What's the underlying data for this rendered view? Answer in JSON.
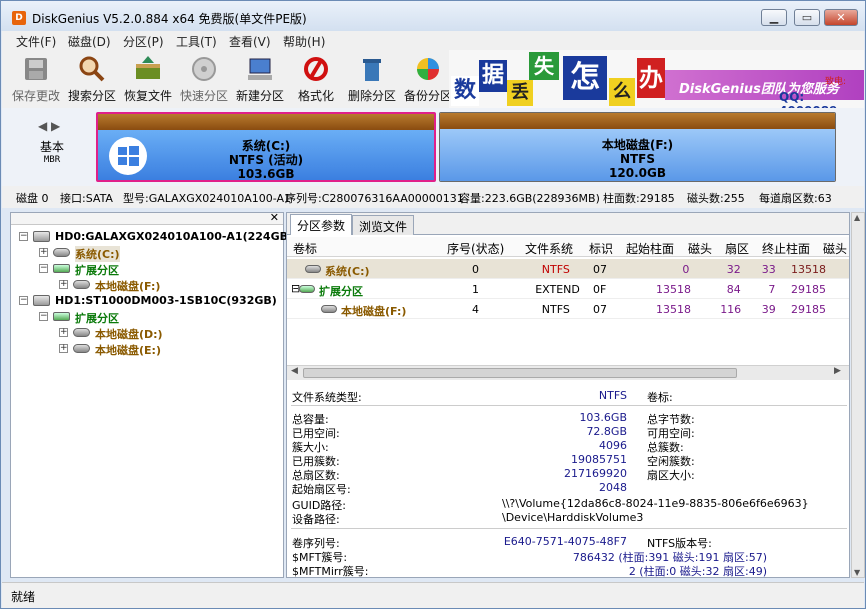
{
  "window": {
    "title": "DiskGenius V5.2.0.884 x64 免费版(单文件PE版)"
  },
  "menu": [
    "文件(F)",
    "磁盘(D)",
    "分区(P)",
    "工具(T)",
    "查看(V)",
    "帮助(H)"
  ],
  "toolbar": [
    {
      "label": "保存更改",
      "icon": "save-changes-icon",
      "enabled": false
    },
    {
      "label": "搜索分区",
      "icon": "search-partition-icon",
      "enabled": true
    },
    {
      "label": "恢复文件",
      "icon": "recover-files-icon",
      "enabled": true
    },
    {
      "label": "快速分区",
      "icon": "quick-partition-icon",
      "enabled": false
    },
    {
      "label": "新建分区",
      "icon": "new-partition-icon",
      "enabled": true
    },
    {
      "label": "格式化",
      "icon": "format-icon",
      "enabled": true
    },
    {
      "label": "删除分区",
      "icon": "delete-partition-icon",
      "enabled": true
    },
    {
      "label": "备份分区",
      "icon": "backup-partition-icon",
      "enabled": true
    }
  ],
  "banner": {
    "chars": [
      "数",
      "据",
      "丢",
      "失",
      "怎",
      "么",
      "办"
    ],
    "brand": "DiskGenius团队为您服务",
    "tag": "致电:",
    "qq": "QQ: 4000089"
  },
  "diskmap": {
    "basic": "基本",
    "mbr": "MBR",
    "partitions": [
      {
        "name": "系统(C:)",
        "fs": "NTFS (活动)",
        "size": "103.6GB",
        "selected": true
      },
      {
        "name": "本地磁盘(F:)",
        "fs": "NTFS",
        "size": "120.0GB",
        "selected": false
      }
    ]
  },
  "diskinfo": {
    "disk": "磁盘 0",
    "iface": "接口:SATA",
    "model": "型号:GALAXGX024010A100-A1",
    "serial": "序列号:C280076316AA00000131",
    "capacity": "容量:223.6GB(228936MB)",
    "cylinders": "柱面数:29185",
    "heads": "磁头数:255",
    "spt": "每道扇区数:63"
  },
  "tree": [
    {
      "label": "HD0:GALAXGX024010A100-A1(224GB)",
      "type": "disk",
      "level": 0,
      "color": "#000"
    },
    {
      "label": "系统(C:)",
      "type": "part",
      "level": 1,
      "color": "#8a5a00"
    },
    {
      "label": "扩展分区",
      "type": "ext",
      "level": 1,
      "color": "#0a7a0a"
    },
    {
      "label": "本地磁盘(F:)",
      "type": "part",
      "level": 2,
      "color": "#8a5a00"
    },
    {
      "label": "HD1:ST1000DM003-1SB10C(932GB)",
      "type": "disk",
      "level": 0,
      "color": "#000"
    },
    {
      "label": "扩展分区",
      "type": "ext",
      "level": 1,
      "color": "#0a7a0a"
    },
    {
      "label": "本地磁盘(D:)",
      "type": "part",
      "level": 2,
      "color": "#8a5a00"
    },
    {
      "label": "本地磁盘(E:)",
      "type": "part",
      "level": 2,
      "color": "#8a5a00"
    }
  ],
  "tabs": [
    "分区参数",
    "浏览文件"
  ],
  "table": {
    "headers": [
      "卷标",
      "序号(状态)",
      "文件系统",
      "标识",
      "起始柱面",
      "磁头",
      "扇区",
      "终止柱面",
      "磁头"
    ],
    "rows": [
      {
        "label": "系统(C:)",
        "num": "0",
        "fs": "NTFS",
        "id": "07",
        "sc": "0",
        "sh": "32",
        "ss": "33",
        "ec": "13518",
        "eh": "84",
        "color": "#8a5a00",
        "fscolor": "#c00000"
      },
      {
        "label": "扩展分区",
        "num": "1",
        "fs": "EXTEND",
        "id": "0F",
        "sc": "13518",
        "sh": "84",
        "ss": "7",
        "ec": "29185",
        "eh": "61",
        "color": "#0a7a0a",
        "fscolor": "#000"
      },
      {
        "label": "本地磁盘(F:)",
        "num": "4",
        "fs": "NTFS",
        "id": "07",
        "sc": "13518",
        "sh": "116",
        "ss": "39",
        "ec": "29185",
        "eh": "48",
        "color": "#8a5a00",
        "fscolor": "#000"
      }
    ]
  },
  "detail": {
    "fstype_l": "文件系统类型:",
    "fstype_v": "NTFS",
    "volname_l": "卷标:",
    "rows": [
      {
        "l": "总容量:",
        "v": "103.6GB",
        "r": "总字节数:"
      },
      {
        "l": "已用空间:",
        "v": "72.8GB",
        "r": "可用空间:"
      },
      {
        "l": "簇大小:",
        "v": "4096",
        "r": "总簇数:"
      },
      {
        "l": "已用簇数:",
        "v": "19085751",
        "r": "空闲簇数:"
      },
      {
        "l": "总扇区数:",
        "v": "217169920",
        "r": "扇区大小:"
      },
      {
        "l": "起始扇区号:",
        "v": "2048",
        "r": ""
      }
    ],
    "guid_l": "GUID路径:",
    "guid_v": "\\\\?\\Volume{12da86c8-8024-11e9-8835-806e6f6e6963}",
    "dev_l": "设备路径:",
    "dev_v": "\\Device\\HarddiskVolume3",
    "serial_l": "卷序列号:",
    "serial_v": "E640-7571-4075-48F7",
    "ntfsver_l": "NTFS版本号:",
    "mft_l": "$MFT簇号:",
    "mft_v": "786432 (柱面:391 磁头:191 扇区:57)",
    "mftm_l": "$MFTMirr簇号:",
    "mftm_v": "2 (柱面:0 磁头:32 扇区:49)"
  },
  "status": "就绪"
}
